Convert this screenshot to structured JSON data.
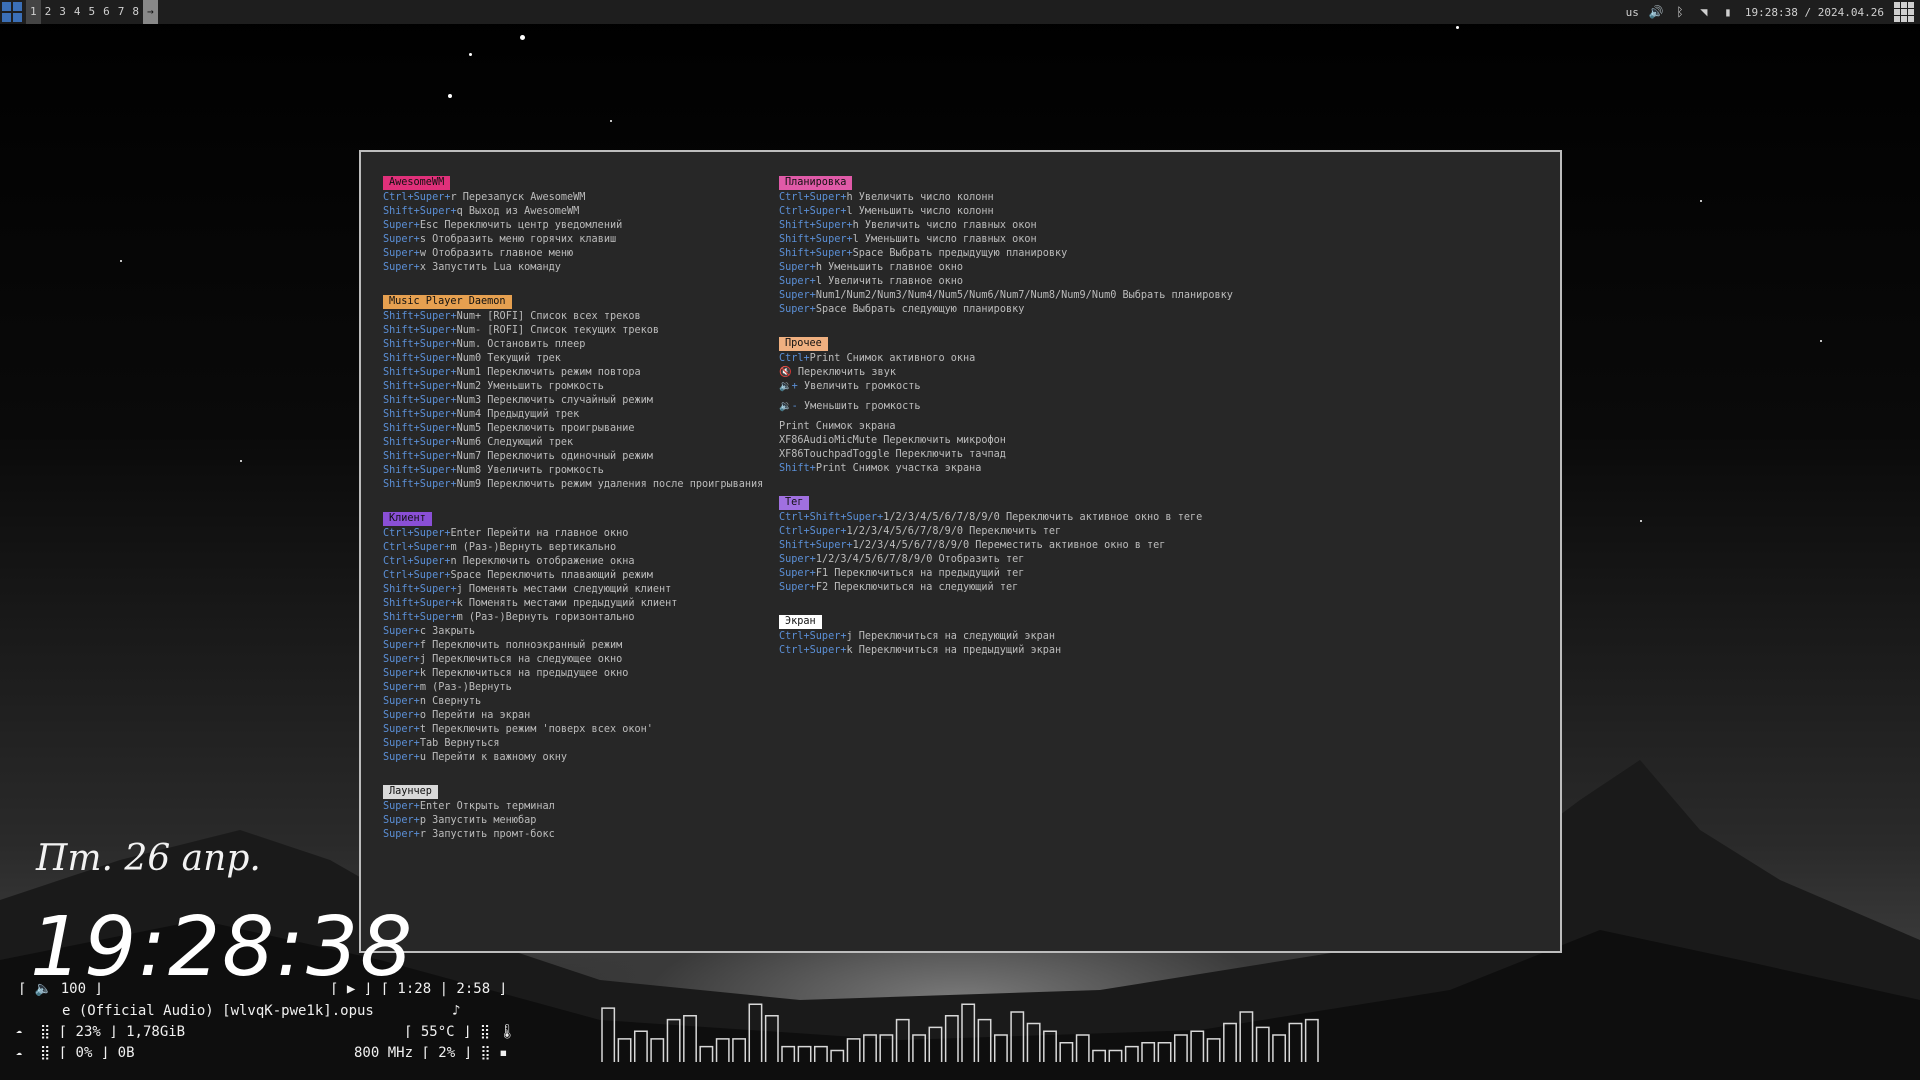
{
  "topbar": {
    "tags": [
      "1",
      "2",
      "3",
      "4",
      "5",
      "6",
      "7",
      "8"
    ],
    "layout_indicator": "us",
    "datetime": "19:28:38 / 2024.04.26"
  },
  "popup": {
    "left": [
      {
        "title": "AwesomeWM",
        "color": "#e0307a",
        "rows": [
          [
            "Ctrl+Super+",
            "r",
            " Перезапуск AwesomeWM"
          ],
          [
            "Shift+Super+",
            "q",
            " Выход из AwesomeWM"
          ],
          [
            "Super+",
            "Esc",
            " Переключить центр уведомлений"
          ],
          [
            "Super+",
            "s",
            " Отобразить меню горячих клавиш"
          ],
          [
            "Super+",
            "w",
            " Отобразить главное меню"
          ],
          [
            "Super+",
            "x",
            " Запустить Lua команду"
          ]
        ]
      },
      {
        "title": "Music Player Daemon",
        "color": "#e6a050",
        "rows": [
          [
            "Shift+Super+",
            "Num+",
            " [ROFI] Список всех треков"
          ],
          [
            "Shift+Super+",
            "Num-",
            " [ROFI] Список текущих треков"
          ],
          [
            "Shift+Super+",
            "Num.",
            " Остановить плеер"
          ],
          [
            "Shift+Super+",
            "Num0",
            " Текущий трек"
          ],
          [
            "Shift+Super+",
            "Num1",
            " Переключить режим повтора"
          ],
          [
            "Shift+Super+",
            "Num2",
            " Уменьшить громкость"
          ],
          [
            "Shift+Super+",
            "Num3",
            " Переключить случайный режим"
          ],
          [
            "Shift+Super+",
            "Num4",
            " Предыдущий трек"
          ],
          [
            "Shift+Super+",
            "Num5",
            " Переключить проигрывание"
          ],
          [
            "Shift+Super+",
            "Num6",
            " Следующий трек"
          ],
          [
            "Shift+Super+",
            "Num7",
            " Переключить одиночный режим"
          ],
          [
            "Shift+Super+",
            "Num8",
            " Увеличить громкость"
          ],
          [
            "Shift+Super+",
            "Num9",
            " Переключить режим удаления после проигрывания"
          ]
        ]
      },
      {
        "title": "Клиент",
        "color": "#8a4fd6",
        "rows": [
          [
            "Ctrl+Super+",
            "Enter",
            " Перейти на главное окно"
          ],
          [
            "Ctrl+Super+",
            "m",
            " (Раз-)Вернуть вертикально"
          ],
          [
            "Ctrl+Super+",
            "n",
            " Переключить отображение окна"
          ],
          [
            "Ctrl+Super+",
            "Space",
            " Переключить плавающий режим"
          ],
          [
            "Shift+Super+",
            "j",
            " Поменять местами следующий клиент"
          ],
          [
            "Shift+Super+",
            "k",
            " Поменять местами предыдущий клиент"
          ],
          [
            "Shift+Super+",
            "m",
            " (Раз-)Вернуть горизонтально"
          ],
          [
            "Super+",
            "c",
            " Закрыть"
          ],
          [
            "Super+",
            "f",
            " Переключить полноэкранный режим"
          ],
          [
            "Super+",
            "j",
            " Переключиться на следующее окно"
          ],
          [
            "Super+",
            "k",
            " Переключиться на предыдущее окно"
          ],
          [
            "Super+",
            "m",
            " (Раз-)Вернуть"
          ],
          [
            "Super+",
            "n",
            " Свернуть"
          ],
          [
            "Super+",
            "o",
            " Перейти на экран"
          ],
          [
            "Super+",
            "t",
            " Переключить режим 'поверх всех окон'"
          ],
          [
            "Super+",
            "Tab",
            " Вернуться"
          ],
          [
            "Super+",
            "u",
            " Перейти к важному окну"
          ]
        ]
      },
      {
        "title": "Лаунчер",
        "color": "#d9d9d9",
        "rows": [
          [
            "Super+",
            "Enter",
            " Открыть терминал"
          ],
          [
            "Super+",
            "p",
            " Запустить менюбар"
          ],
          [
            "Super+",
            "r",
            " Запустить промт-бокс"
          ]
        ]
      }
    ],
    "right": [
      {
        "title": "Планировка",
        "color": "#e05aa8",
        "rows": [
          [
            "Ctrl+Super+",
            "h",
            " Увеличить число колонн"
          ],
          [
            "Ctrl+Super+",
            "l",
            " Уменьшить число колонн"
          ],
          [
            "Shift+Super+",
            "h",
            " Увеличить число главных окон"
          ],
          [
            "Shift+Super+",
            "l",
            " Уменьшить число главных окон"
          ],
          [
            "Shift+Super+",
            "Space",
            " Выбрать предыдущую планировку"
          ],
          [
            "Super+",
            "h",
            " Уменьшить главное окно"
          ],
          [
            "Super+",
            "l",
            " Увеличить главное окно"
          ],
          [
            "Super+",
            "Num1/Num2/Num3/Num4/Num5/Num6/Num7/Num8/Num9/Num0",
            " Выбрать планировку"
          ],
          [
            "Super+",
            "Space",
            " Выбрать следующую планировку"
          ]
        ]
      },
      {
        "title": "Прочее",
        "color": "#f0b080",
        "rows": [
          [
            "Ctrl+",
            "Print",
            " Снимок активного окна"
          ],
          [
            "🔇",
            "",
            " Переключить звук"
          ],
          [
            "🔉+",
            "",
            " Увеличить громкость"
          ],
          [
            "🔉-",
            "",
            " Уменьшить громкость"
          ],
          [
            "",
            "Print",
            " Снимок экрана"
          ],
          [
            "",
            "XF86AudioMicMute",
            " Переключить микрофон"
          ],
          [
            "",
            "XF86TouchpadToggle",
            " Переключить тачпад"
          ],
          [
            "Shift+",
            "Print",
            " Снимок участка экрана"
          ]
        ]
      },
      {
        "title": "Тег",
        "color": "#a070e0",
        "rows": [
          [
            "Ctrl+Shift+Super+",
            "1/2/3/4/5/6/7/8/9/0",
            " Переключить активное окно в теге"
          ],
          [
            "Ctrl+Super+",
            "1/2/3/4/5/6/7/8/9/0",
            " Переключить тег"
          ],
          [
            "Shift+Super+",
            "1/2/3/4/5/6/7/8/9/0",
            " Переместить активное окно в тег"
          ],
          [
            "Super+",
            "1/2/3/4/5/6/7/8/9/0",
            " Отобразить тег"
          ],
          [
            "Super+",
            "F1",
            " Переключиться на предыдущий тег"
          ],
          [
            "Super+",
            "F2",
            " Переключиться на следующий тег"
          ]
        ]
      },
      {
        "title": "Экран",
        "color": "#ffffff",
        "rows": [
          [
            "Ctrl+Super+",
            "j",
            " Переключиться на следующий экран"
          ],
          [
            "Ctrl+Super+",
            "k",
            " Переключиться на предыдущий экран"
          ]
        ]
      }
    ]
  },
  "conky": {
    "date": "Пт. 26 апр.",
    "time": "19:28:38",
    "volume": "⌈ 🔈 100 ⌋",
    "player": "⌈ ▶ ⌋ ⌈ 1:28 | 2:58 ⌋",
    "track": "e (Official Audio) [wlvqK-pwe1k].opus",
    "note": "♪",
    "mem": "⣿ ⌈ 23% ⌋ 1,78GiB",
    "temp": "⌈ 55°C ⌋ ⣿ 🌡",
    "disk": "⣿ ⌈ 0% ⌋ 0B",
    "cpu": "800 MHz ⌈ 2% ⌋ ⣿ ▪"
  },
  "visualizer": {
    "levels": [
      0.7,
      0.3,
      0.4,
      0.3,
      0.55,
      0.6,
      0.2,
      0.3,
      0.3,
      0.75,
      0.6,
      0.2,
      0.2,
      0.2,
      0.15,
      0.3,
      0.35,
      0.35,
      0.55,
      0.35,
      0.45,
      0.6,
      0.75,
      0.55,
      0.35,
      0.65,
      0.5,
      0.4,
      0.25,
      0.35,
      0.15,
      0.15,
      0.2,
      0.25,
      0.25,
      0.35,
      0.4,
      0.3,
      0.5,
      0.65,
      0.45,
      0.35,
      0.5,
      0.55
    ]
  }
}
